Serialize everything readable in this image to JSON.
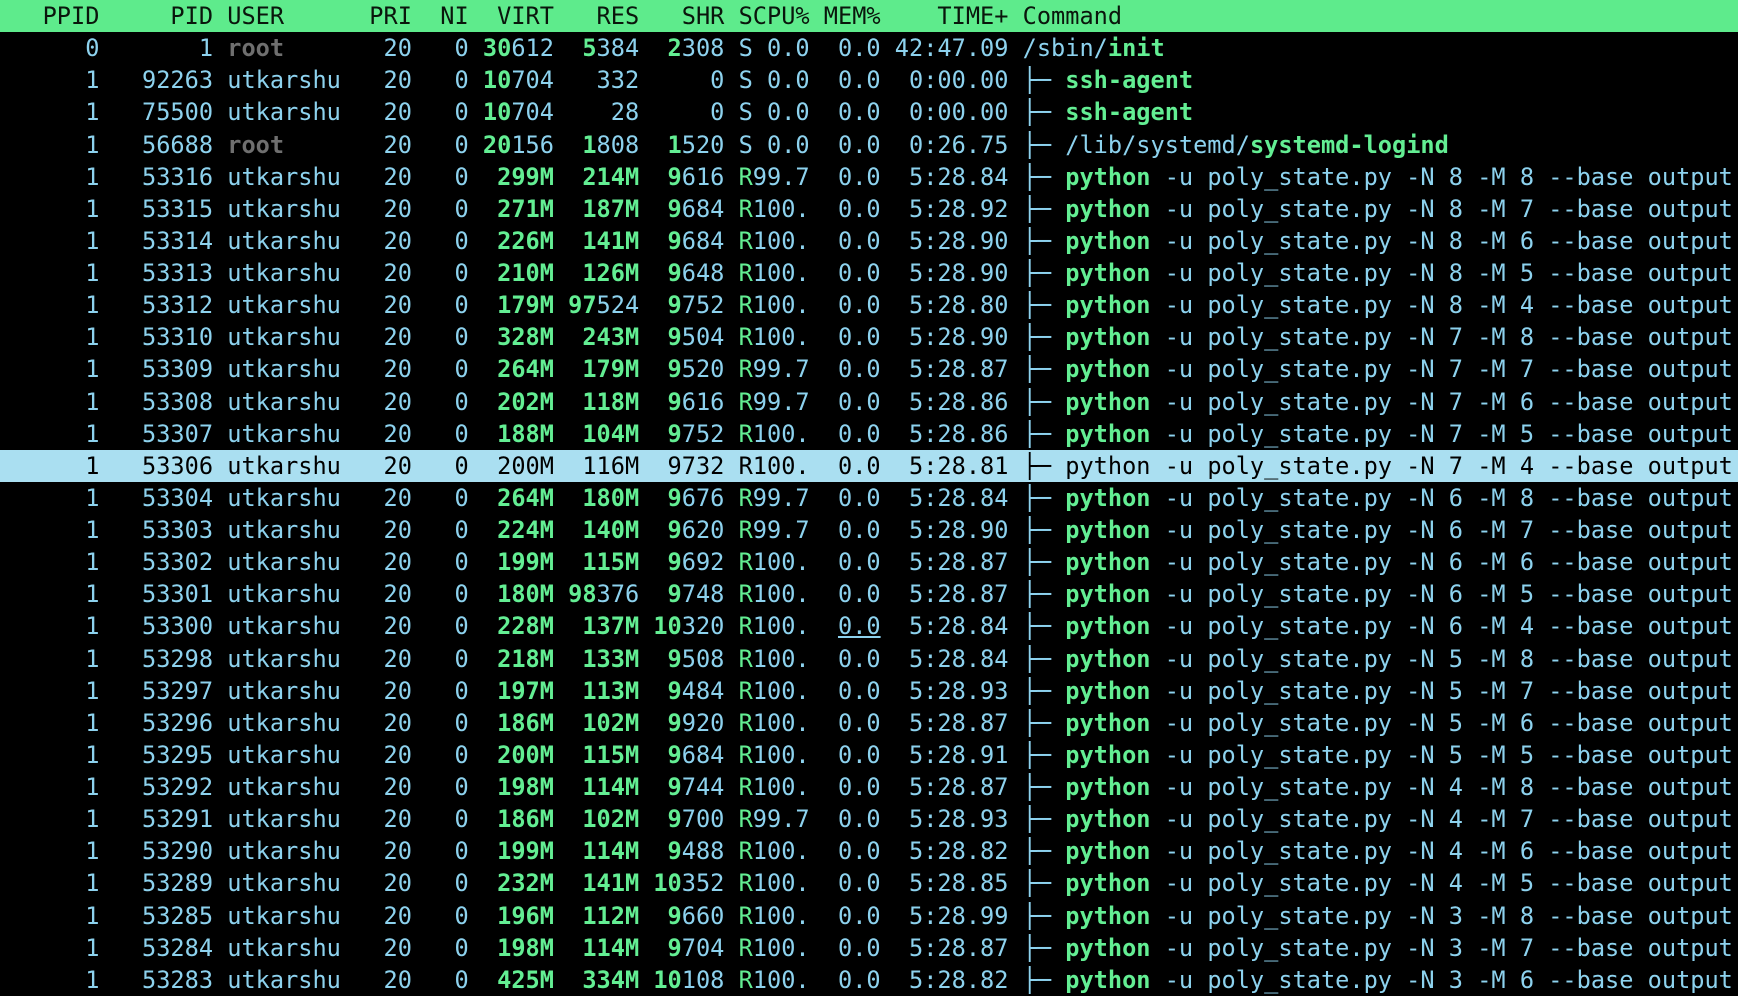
{
  "app": {
    "name": "htop-process-list",
    "selected_pid": "53306"
  },
  "colors": {
    "background": "#000000",
    "text_cyan": "#8dd2ee",
    "text_green": "#63ee93",
    "text_grey": "#6f6f6f",
    "header_background": "#5eeb8c",
    "header_text": "#0a160c",
    "selected_row_background": "#aadff1",
    "selected_row_text": "#000000"
  },
  "table": {
    "headers": [
      "PPID",
      "PID",
      "USER",
      "PRI",
      "NI",
      "VIRT",
      "RES",
      "SHR",
      "S",
      "CPU%",
      "MEM%",
      "TIME+",
      "Command"
    ],
    "rows": [
      {
        "ppid": "0",
        "pid": "1",
        "user": "root",
        "ug": "grey",
        "pri": "20",
        "ni": "0",
        "virt": [
          "30",
          "612"
        ],
        "res": [
          "5",
          "384"
        ],
        "shr": [
          "2",
          "308"
        ],
        "s": "S",
        "cpu": "0.0",
        "mem": "0.0",
        "time": "42:47.09",
        "tree": "",
        "cmd": [
          "/sbin/",
          "init",
          ""
        ]
      },
      {
        "ppid": "1",
        "pid": "92263",
        "user": "utkarshu",
        "pri": "20",
        "ni": "0",
        "virt": [
          "10",
          "704"
        ],
        "res": [
          "",
          "332"
        ],
        "shr": [
          "",
          "0"
        ],
        "s": "S",
        "cpu": "0.0",
        "mem": "0.0",
        "time": "0:00.00",
        "tree": "├─ ",
        "cmd": [
          "",
          "ssh-agent",
          ""
        ]
      },
      {
        "ppid": "1",
        "pid": "75500",
        "user": "utkarshu",
        "pri": "20",
        "ni": "0",
        "virt": [
          "10",
          "704"
        ],
        "res": [
          "",
          "28"
        ],
        "shr": [
          "",
          "0"
        ],
        "s": "S",
        "cpu": "0.0",
        "mem": "0.0",
        "time": "0:00.00",
        "tree": "├─ ",
        "cmd": [
          "",
          "ssh-agent",
          ""
        ]
      },
      {
        "ppid": "1",
        "pid": "56688",
        "user": "root",
        "ug": "grey",
        "pri": "20",
        "ni": "0",
        "virt": [
          "20",
          "156"
        ],
        "res": [
          "1",
          "808"
        ],
        "shr": [
          "1",
          "520"
        ],
        "s": "S",
        "cpu": "0.0",
        "mem": "0.0",
        "time": "0:26.75",
        "tree": "├─ ",
        "cmd": [
          "/lib/systemd/",
          "systemd-logind",
          ""
        ]
      },
      {
        "ppid": "1",
        "pid": "53316",
        "user": "utkarshu",
        "pri": "20",
        "ni": "0",
        "virt": [
          "299M",
          ""
        ],
        "res": [
          "214M",
          ""
        ],
        "shr": [
          "9",
          "616"
        ],
        "s": "R",
        "cpu": "99.7",
        "mem": "0.0",
        "time": "5:28.84",
        "tree": "├─ ",
        "cmd": [
          "",
          "python",
          " -u poly_state.py -N 8 -M 8 --base output"
        ]
      },
      {
        "ppid": "1",
        "pid": "53315",
        "user": "utkarshu",
        "pri": "20",
        "ni": "0",
        "virt": [
          "271M",
          ""
        ],
        "res": [
          "187M",
          ""
        ],
        "shr": [
          "9",
          "684"
        ],
        "s": "R",
        "cpu": "100.",
        "mem": "0.0",
        "time": "5:28.92",
        "tree": "├─ ",
        "cmd": [
          "",
          "python",
          " -u poly_state.py -N 8 -M 7 --base output"
        ]
      },
      {
        "ppid": "1",
        "pid": "53314",
        "user": "utkarshu",
        "pri": "20",
        "ni": "0",
        "virt": [
          "226M",
          ""
        ],
        "res": [
          "141M",
          ""
        ],
        "shr": [
          "9",
          "684"
        ],
        "s": "R",
        "cpu": "100.",
        "mem": "0.0",
        "time": "5:28.90",
        "tree": "├─ ",
        "cmd": [
          "",
          "python",
          " -u poly_state.py -N 8 -M 6 --base output"
        ]
      },
      {
        "ppid": "1",
        "pid": "53313",
        "user": "utkarshu",
        "pri": "20",
        "ni": "0",
        "virt": [
          "210M",
          ""
        ],
        "res": [
          "126M",
          ""
        ],
        "shr": [
          "9",
          "648"
        ],
        "s": "R",
        "cpu": "100.",
        "mem": "0.0",
        "time": "5:28.90",
        "tree": "├─ ",
        "cmd": [
          "",
          "python",
          " -u poly_state.py -N 8 -M 5 --base output"
        ]
      },
      {
        "ppid": "1",
        "pid": "53312",
        "user": "utkarshu",
        "pri": "20",
        "ni": "0",
        "virt": [
          "179M",
          ""
        ],
        "res": [
          "97",
          "524"
        ],
        "shr": [
          "9",
          "752"
        ],
        "s": "R",
        "cpu": "100.",
        "mem": "0.0",
        "time": "5:28.80",
        "tree": "├─ ",
        "cmd": [
          "",
          "python",
          " -u poly_state.py -N 8 -M 4 --base output"
        ]
      },
      {
        "ppid": "1",
        "pid": "53310",
        "user": "utkarshu",
        "pri": "20",
        "ni": "0",
        "virt": [
          "328M",
          ""
        ],
        "res": [
          "243M",
          ""
        ],
        "shr": [
          "9",
          "504"
        ],
        "s": "R",
        "cpu": "100.",
        "mem": "0.0",
        "time": "5:28.90",
        "tree": "├─ ",
        "cmd": [
          "",
          "python",
          " -u poly_state.py -N 7 -M 8 --base output"
        ]
      },
      {
        "ppid": "1",
        "pid": "53309",
        "user": "utkarshu",
        "pri": "20",
        "ni": "0",
        "virt": [
          "264M",
          ""
        ],
        "res": [
          "179M",
          ""
        ],
        "shr": [
          "9",
          "520"
        ],
        "s": "R",
        "cpu": "99.7",
        "mem": "0.0",
        "time": "5:28.87",
        "tree": "├─ ",
        "cmd": [
          "",
          "python",
          " -u poly_state.py -N 7 -M 7 --base output"
        ]
      },
      {
        "ppid": "1",
        "pid": "53308",
        "user": "utkarshu",
        "pri": "20",
        "ni": "0",
        "virt": [
          "202M",
          ""
        ],
        "res": [
          "118M",
          ""
        ],
        "shr": [
          "9",
          "616"
        ],
        "s": "R",
        "cpu": "99.7",
        "mem": "0.0",
        "time": "5:28.86",
        "tree": "├─ ",
        "cmd": [
          "",
          "python",
          " -u poly_state.py -N 7 -M 6 --base output"
        ]
      },
      {
        "ppid": "1",
        "pid": "53307",
        "user": "utkarshu",
        "pri": "20",
        "ni": "0",
        "virt": [
          "188M",
          ""
        ],
        "res": [
          "104M",
          ""
        ],
        "shr": [
          "9",
          "752"
        ],
        "s": "R",
        "cpu": "100.",
        "mem": "0.0",
        "time": "5:28.86",
        "tree": "├─ ",
        "cmd": [
          "",
          "python",
          " -u poly_state.py -N 7 -M 5 --base output"
        ]
      },
      {
        "ppid": "1",
        "pid": "53306",
        "user": "utkarshu",
        "pri": "20",
        "ni": "0",
        "virt": [
          "200M",
          ""
        ],
        "res": [
          "116M",
          ""
        ],
        "shr": [
          "9",
          "732"
        ],
        "s": "R",
        "cpu": "100.",
        "mem": "0.0",
        "time": "5:28.81",
        "tree": "├─ ",
        "cmd": [
          "",
          "python",
          " -u poly_state.py -N 7 -M 4 --base output"
        ],
        "sel": true
      },
      {
        "ppid": "1",
        "pid": "53304",
        "user": "utkarshu",
        "pri": "20",
        "ni": "0",
        "virt": [
          "264M",
          ""
        ],
        "res": [
          "180M",
          ""
        ],
        "shr": [
          "9",
          "676"
        ],
        "s": "R",
        "cpu": "99.7",
        "mem": "0.0",
        "time": "5:28.84",
        "tree": "├─ ",
        "cmd": [
          "",
          "python",
          " -u poly_state.py -N 6 -M 8 --base output"
        ]
      },
      {
        "ppid": "1",
        "pid": "53303",
        "user": "utkarshu",
        "pri": "20",
        "ni": "0",
        "virt": [
          "224M",
          ""
        ],
        "res": [
          "140M",
          ""
        ],
        "shr": [
          "9",
          "620"
        ],
        "s": "R",
        "cpu": "99.7",
        "mem": "0.0",
        "time": "5:28.90",
        "tree": "├─ ",
        "cmd": [
          "",
          "python",
          " -u poly_state.py -N 6 -M 7 --base output"
        ]
      },
      {
        "ppid": "1",
        "pid": "53302",
        "user": "utkarshu",
        "pri": "20",
        "ni": "0",
        "virt": [
          "199M",
          ""
        ],
        "res": [
          "115M",
          ""
        ],
        "shr": [
          "9",
          "692"
        ],
        "s": "R",
        "cpu": "100.",
        "mem": "0.0",
        "time": "5:28.87",
        "tree": "├─ ",
        "cmd": [
          "",
          "python",
          " -u poly_state.py -N 6 -M 6 --base output"
        ]
      },
      {
        "ppid": "1",
        "pid": "53301",
        "user": "utkarshu",
        "pri": "20",
        "ni": "0",
        "virt": [
          "180M",
          ""
        ],
        "res": [
          "98",
          "376"
        ],
        "shr": [
          "9",
          "748"
        ],
        "s": "R",
        "cpu": "100.",
        "mem": "0.0",
        "time": "5:28.87",
        "tree": "├─ ",
        "cmd": [
          "",
          "python",
          " -u poly_state.py -N 6 -M 5 --base output"
        ]
      },
      {
        "ppid": "1",
        "pid": "53300",
        "user": "utkarshu",
        "pri": "20",
        "ni": "0",
        "virt": [
          "228M",
          ""
        ],
        "res": [
          "137M",
          ""
        ],
        "shr": [
          "10",
          "320"
        ],
        "s": "R",
        "cpu": "100.",
        "mem": "0.0",
        "memu": true,
        "time": "5:28.84",
        "tree": "├─ ",
        "cmd": [
          "",
          "python",
          " -u poly_state.py -N 6 -M 4 --base output"
        ]
      },
      {
        "ppid": "1",
        "pid": "53298",
        "user": "utkarshu",
        "pri": "20",
        "ni": "0",
        "virt": [
          "218M",
          ""
        ],
        "res": [
          "133M",
          ""
        ],
        "shr": [
          "9",
          "508"
        ],
        "s": "R",
        "cpu": "100.",
        "mem": "0.0",
        "time": "5:28.84",
        "tree": "├─ ",
        "cmd": [
          "",
          "python",
          " -u poly_state.py -N 5 -M 8 --base output"
        ]
      },
      {
        "ppid": "1",
        "pid": "53297",
        "user": "utkarshu",
        "pri": "20",
        "ni": "0",
        "virt": [
          "197M",
          ""
        ],
        "res": [
          "113M",
          ""
        ],
        "shr": [
          "9",
          "484"
        ],
        "s": "R",
        "cpu": "100.",
        "mem": "0.0",
        "time": "5:28.93",
        "tree": "├─ ",
        "cmd": [
          "",
          "python",
          " -u poly_state.py -N 5 -M 7 --base output"
        ]
      },
      {
        "ppid": "1",
        "pid": "53296",
        "user": "utkarshu",
        "pri": "20",
        "ni": "0",
        "virt": [
          "186M",
          ""
        ],
        "res": [
          "102M",
          ""
        ],
        "shr": [
          "9",
          "920"
        ],
        "s": "R",
        "cpu": "100.",
        "mem": "0.0",
        "time": "5:28.87",
        "tree": "├─ ",
        "cmd": [
          "",
          "python",
          " -u poly_state.py -N 5 -M 6 --base output"
        ]
      },
      {
        "ppid": "1",
        "pid": "53295",
        "user": "utkarshu",
        "pri": "20",
        "ni": "0",
        "virt": [
          "200M",
          ""
        ],
        "res": [
          "115M",
          ""
        ],
        "shr": [
          "9",
          "684"
        ],
        "s": "R",
        "cpu": "100.",
        "mem": "0.0",
        "time": "5:28.91",
        "tree": "├─ ",
        "cmd": [
          "",
          "python",
          " -u poly_state.py -N 5 -M 5 --base output"
        ]
      },
      {
        "ppid": "1",
        "pid": "53292",
        "user": "utkarshu",
        "pri": "20",
        "ni": "0",
        "virt": [
          "198M",
          ""
        ],
        "res": [
          "114M",
          ""
        ],
        "shr": [
          "9",
          "744"
        ],
        "s": "R",
        "cpu": "100.",
        "mem": "0.0",
        "time": "5:28.87",
        "tree": "├─ ",
        "cmd": [
          "",
          "python",
          " -u poly_state.py -N 4 -M 8 --base output"
        ]
      },
      {
        "ppid": "1",
        "pid": "53291",
        "user": "utkarshu",
        "pri": "20",
        "ni": "0",
        "virt": [
          "186M",
          ""
        ],
        "res": [
          "102M",
          ""
        ],
        "shr": [
          "9",
          "700"
        ],
        "s": "R",
        "cpu": "99.7",
        "mem": "0.0",
        "time": "5:28.93",
        "tree": "├─ ",
        "cmd": [
          "",
          "python",
          " -u poly_state.py -N 4 -M 7 --base output"
        ]
      },
      {
        "ppid": "1",
        "pid": "53290",
        "user": "utkarshu",
        "pri": "20",
        "ni": "0",
        "virt": [
          "199M",
          ""
        ],
        "res": [
          "114M",
          ""
        ],
        "shr": [
          "9",
          "488"
        ],
        "s": "R",
        "cpu": "100.",
        "mem": "0.0",
        "time": "5:28.82",
        "tree": "├─ ",
        "cmd": [
          "",
          "python",
          " -u poly_state.py -N 4 -M 6 --base output"
        ]
      },
      {
        "ppid": "1",
        "pid": "53289",
        "user": "utkarshu",
        "pri": "20",
        "ni": "0",
        "virt": [
          "232M",
          ""
        ],
        "res": [
          "141M",
          ""
        ],
        "shr": [
          "10",
          "352"
        ],
        "s": "R",
        "cpu": "100.",
        "mem": "0.0",
        "time": "5:28.85",
        "tree": "├─ ",
        "cmd": [
          "",
          "python",
          " -u poly_state.py -N 4 -M 5 --base output"
        ]
      },
      {
        "ppid": "1",
        "pid": "53285",
        "user": "utkarshu",
        "pri": "20",
        "ni": "0",
        "virt": [
          "196M",
          ""
        ],
        "res": [
          "112M",
          ""
        ],
        "shr": [
          "9",
          "660"
        ],
        "s": "R",
        "cpu": "100.",
        "mem": "0.0",
        "time": "5:28.99",
        "tree": "├─ ",
        "cmd": [
          "",
          "python",
          " -u poly_state.py -N 3 -M 8 --base output"
        ]
      },
      {
        "ppid": "1",
        "pid": "53284",
        "user": "utkarshu",
        "pri": "20",
        "ni": "0",
        "virt": [
          "198M",
          ""
        ],
        "res": [
          "114M",
          ""
        ],
        "shr": [
          "9",
          "704"
        ],
        "s": "R",
        "cpu": "100.",
        "mem": "0.0",
        "time": "5:28.87",
        "tree": "├─ ",
        "cmd": [
          "",
          "python",
          " -u poly_state.py -N 3 -M 7 --base output"
        ]
      },
      {
        "ppid": "1",
        "pid": "53283",
        "user": "utkarshu",
        "pri": "20",
        "ni": "0",
        "virt": [
          "425M",
          ""
        ],
        "res": [
          "334M",
          ""
        ],
        "shr": [
          "10",
          "108"
        ],
        "s": "R",
        "cpu": "100.",
        "mem": "0.0",
        "time": "5:28.82",
        "tree": "├─ ",
        "cmd": [
          "",
          "python",
          " -u poly_state.py -N 3 -M 6 --base output"
        ]
      }
    ]
  }
}
